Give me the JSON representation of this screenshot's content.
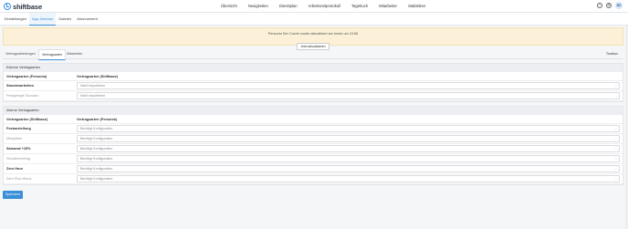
{
  "brand": "shiftbase",
  "main_nav": [
    "Übersicht",
    "Neuigkeiten",
    "Dienstplan",
    "Arbeitszeitprotokoll",
    "Tagebuch",
    "Mitarbeiter",
    "Statistiken"
  ],
  "user_initials": "BS",
  "sub_nav": {
    "tabs": [
      "Einstellungen",
      "App-Zentrum",
      "Dateien",
      "Abonnement"
    ],
    "active": "App-Zentrum"
  },
  "banner": {
    "message": "Personio Der Cache wurde aktualisiert am heute um 10:56",
    "button": "Jetzt aktualisieren"
  },
  "inner_tabs": {
    "tabs": [
      "Vertragsabteilungen",
      "Vertragsarten",
      "Mitarbeiter"
    ],
    "active": "Vertragsarten",
    "toolbox": "Toolbox"
  },
  "external": {
    "title": "Externe Vertragsarten",
    "col1": "Vertragsarten (Personio)",
    "col2": "Vertragsarten (Shiftbase)",
    "rows": [
      {
        "label": "Stundenarbeiten",
        "value": "Nicht importieren",
        "bold": true
      },
      {
        "label": "Festgelegte Stunden",
        "value": "Nicht importieren",
        "bold": false
      }
    ]
  },
  "internal": {
    "title": "Interne Vertragsarten",
    "col1": "Vertragsarten (Shiftbase)",
    "col2": "Vertragsarten (Personio)",
    "rows": [
      {
        "label": "Festanstellung",
        "value": "Benötigt Konfiguration",
        "bold": true
      },
      {
        "label": "Minijobber",
        "value": "Benötigt Konfiguration",
        "bold": false
      },
      {
        "label": "Saisonal +25%",
        "value": "Benötigt Konfiguration",
        "bold": true
      },
      {
        "label": "Stundenvertrag",
        "value": "Benötigt Konfiguration",
        "bold": false
      },
      {
        "label": "Zero Hour",
        "value": "Benötigt Konfiguration",
        "bold": true
      },
      {
        "label": "Zero Plus Minus",
        "value": "Benötigt Konfiguration",
        "bold": false
      }
    ]
  },
  "save_label": "Speichern"
}
